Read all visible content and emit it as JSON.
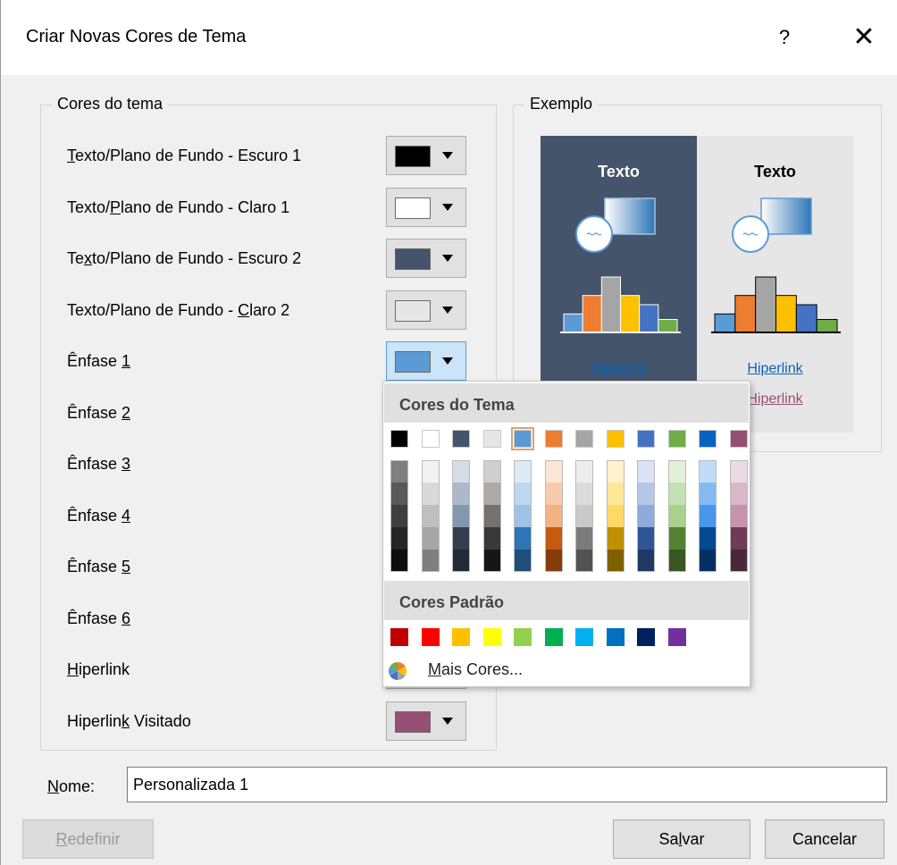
{
  "window": {
    "title": "Criar Novas Cores de Tema",
    "help_label": "?",
    "close_label": "✕"
  },
  "theme_colors": {
    "title": "Cores do tema",
    "rows": [
      {
        "pre": "",
        "key": "T",
        "post": "exto/Plano de Fundo - Escuro 1",
        "color": "#000000"
      },
      {
        "pre": "Texto/",
        "key": "P",
        "post": "lano de Fundo - Claro 1",
        "color": "#ffffff"
      },
      {
        "pre": "Te",
        "key": "x",
        "post": "to/Plano de Fundo - Escuro 2",
        "color": "#44546a"
      },
      {
        "pre": "Texto/Plano de Fundo - ",
        "key": "C",
        "post": "laro 2",
        "color": "#e7e6e6"
      },
      {
        "pre": "Ênfase ",
        "key": "1",
        "post": "",
        "color": "#5b9bd5"
      },
      {
        "pre": "Ênfase ",
        "key": "2",
        "post": "",
        "color": "#ed7d31"
      },
      {
        "pre": "Ênfase ",
        "key": "3",
        "post": "",
        "color": "#a5a5a5"
      },
      {
        "pre": "Ênfase ",
        "key": "4",
        "post": "",
        "color": "#ffc000"
      },
      {
        "pre": "Ênfase ",
        "key": "5",
        "post": "",
        "color": "#4472c4"
      },
      {
        "pre": "Ênfase ",
        "key": "6",
        "post": "",
        "color": "#70ad47"
      },
      {
        "pre": "",
        "key": "H",
        "post": "iperlink",
        "color": "#0563c1"
      },
      {
        "pre": "Hiperlin",
        "key": "k",
        "post": " Visitado",
        "color": "#954f72"
      }
    ]
  },
  "example": {
    "title": "Exemplo",
    "dark_bg": "#44546a",
    "light_bg": "#e7e6e6",
    "text_label": "Texto",
    "hyperlink_label": "Hiperlink",
    "visited_label": "Hiperlink",
    "hyperlink_color": "#0563c1",
    "visited_color": "#954f72",
    "bars": [
      {
        "color": "#5b9bd5",
        "value": 1
      },
      {
        "color": "#ed7d31",
        "value": 2
      },
      {
        "color": "#a5a5a5",
        "value": 3
      },
      {
        "color": "#ffc000",
        "value": 2
      },
      {
        "color": "#4472c4",
        "value": 1.5
      },
      {
        "color": "#70ad47",
        "value": 0.7
      }
    ]
  },
  "palette": {
    "theme_header": "Cores do Tema",
    "standard_header": "Cores Padrão",
    "more_colors_pre": "",
    "more_colors_key": "M",
    "more_colors_post": "ais Cores...",
    "selected_index": 4,
    "theme_columns": [
      {
        "base": "#000000",
        "shades": [
          "#7f7f7f",
          "#595959",
          "#3f3f3f",
          "#262626",
          "#0d0d0d"
        ]
      },
      {
        "base": "#ffffff",
        "shades": [
          "#f2f2f2",
          "#d9d9d9",
          "#bfbfbf",
          "#a6a6a6",
          "#7f7f7f"
        ]
      },
      {
        "base": "#44546a",
        "shades": [
          "#d6dce4",
          "#adb9ca",
          "#8497b0",
          "#333f4f",
          "#222a35"
        ]
      },
      {
        "base": "#e7e6e6",
        "shades": [
          "#d0cece",
          "#aeaaaa",
          "#757171",
          "#3a3838",
          "#171616"
        ]
      },
      {
        "base": "#5b9bd5",
        "shades": [
          "#deebf6",
          "#bdd7ee",
          "#9dc3e6",
          "#2e75b5",
          "#1f4e79"
        ]
      },
      {
        "base": "#ed7d31",
        "shades": [
          "#fbe5d5",
          "#f8cbad",
          "#f4b183",
          "#c55a11",
          "#843c0b"
        ]
      },
      {
        "base": "#a5a5a5",
        "shades": [
          "#ededed",
          "#dbdbdb",
          "#c9c9c9",
          "#7b7b7b",
          "#525252"
        ]
      },
      {
        "base": "#ffc000",
        "shades": [
          "#fff2cc",
          "#ffe699",
          "#ffd966",
          "#bf9000",
          "#7f6000"
        ]
      },
      {
        "base": "#4472c4",
        "shades": [
          "#dae3f3",
          "#b4c7e7",
          "#8faadc",
          "#2f5597",
          "#203864"
        ]
      },
      {
        "base": "#70ad47",
        "shades": [
          "#e2f0d9",
          "#c5e0b4",
          "#a9d18e",
          "#548235",
          "#385723"
        ]
      },
      {
        "base": "#0563c1",
        "shades": [
          "#c1dcf8",
          "#84baf2",
          "#4797eb",
          "#044a91",
          "#023161"
        ]
      },
      {
        "base": "#954f72",
        "shades": [
          "#ecdae3",
          "#d9b6c8",
          "#c692ac",
          "#6f3b55",
          "#4a2739"
        ]
      }
    ],
    "standard_colors": [
      "#c00000",
      "#ff0000",
      "#ffc000",
      "#ffff00",
      "#92d050",
      "#00b050",
      "#00b0f0",
      "#0070c0",
      "#002060",
      "#7030a0"
    ]
  },
  "name_field": {
    "label_key": "N",
    "label_post": "ome:",
    "value": "Personalizada 1"
  },
  "buttons": {
    "reset_key": "R",
    "reset_post": "edefinir",
    "save_pre": "Sa",
    "save_key": "l",
    "save_post": "var",
    "cancel": "Cancelar"
  }
}
